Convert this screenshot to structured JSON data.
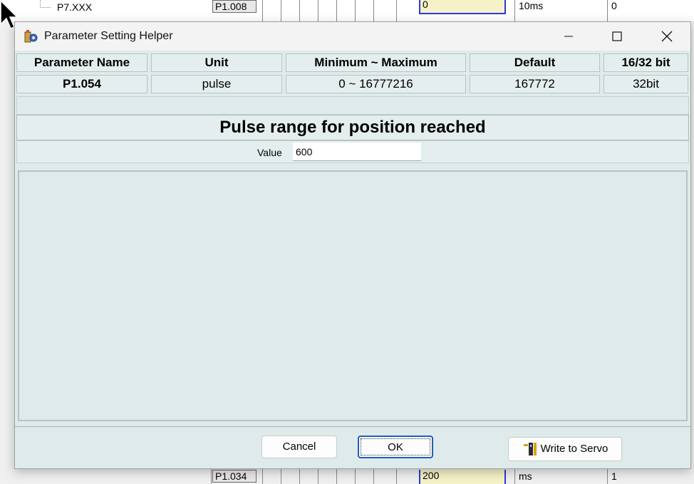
{
  "background": {
    "top_row": {
      "tree_label": "P7.XXX",
      "param": "P1.008",
      "value": "0",
      "unit": "10ms",
      "default": "0"
    },
    "bottom_row": {
      "param": "P1.034",
      "value": "200",
      "unit": "ms",
      "default": "1"
    }
  },
  "dialog": {
    "title": "Parameter Setting Helper",
    "app_icon": "parameter-helper-icon",
    "table": {
      "headers": [
        "Parameter Name",
        "Unit",
        "Minimum ~ Maximum",
        "Default",
        "16/32 bit"
      ],
      "row": [
        "P1.054",
        "pulse",
        "0 ~ 16777216",
        "167772",
        "32bit"
      ]
    },
    "description_title": "Pulse range for position reached",
    "value_label": "Value",
    "value": "600",
    "buttons": {
      "cancel": "Cancel",
      "ok": "OK",
      "write_to_servo": "Write to Servo"
    }
  },
  "colors": {
    "dialog_bg": "#dfeaea",
    "highlight_border": "#2a3bd6",
    "value_cell_bg": "#f5f2c8"
  }
}
